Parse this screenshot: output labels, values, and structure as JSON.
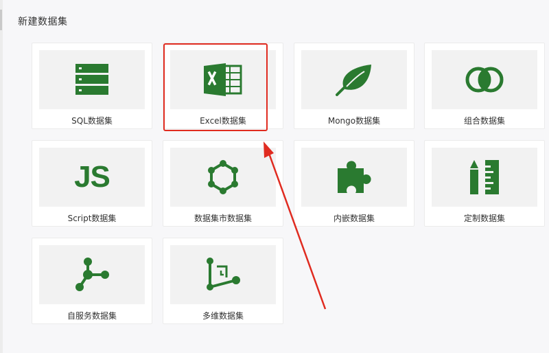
{
  "page": {
    "title": "新建数据集"
  },
  "colors": {
    "icon_green": "#2a7a30",
    "highlight_red": "#e02b20"
  },
  "datasets": [
    {
      "label": "SQL数据集",
      "icon": "database-icon"
    },
    {
      "label": "Excel数据集",
      "icon": "excel-icon"
    },
    {
      "label": "Mongo数据集",
      "icon": "leaf-icon"
    },
    {
      "label": "组合数据集",
      "icon": "overlap-circles-icon"
    },
    {
      "label": "Script数据集",
      "icon": "js-icon",
      "icon_text": "JS"
    },
    {
      "label": "数据集市数据集",
      "icon": "hexagon-network-icon"
    },
    {
      "label": "内嵌数据集",
      "icon": "puzzle-icon"
    },
    {
      "label": "定制数据集",
      "icon": "pencil-ruler-icon"
    },
    {
      "label": "自服务数据集",
      "icon": "branch-node-icon"
    },
    {
      "label": "多维数据集",
      "icon": "cube-axis-icon"
    }
  ]
}
